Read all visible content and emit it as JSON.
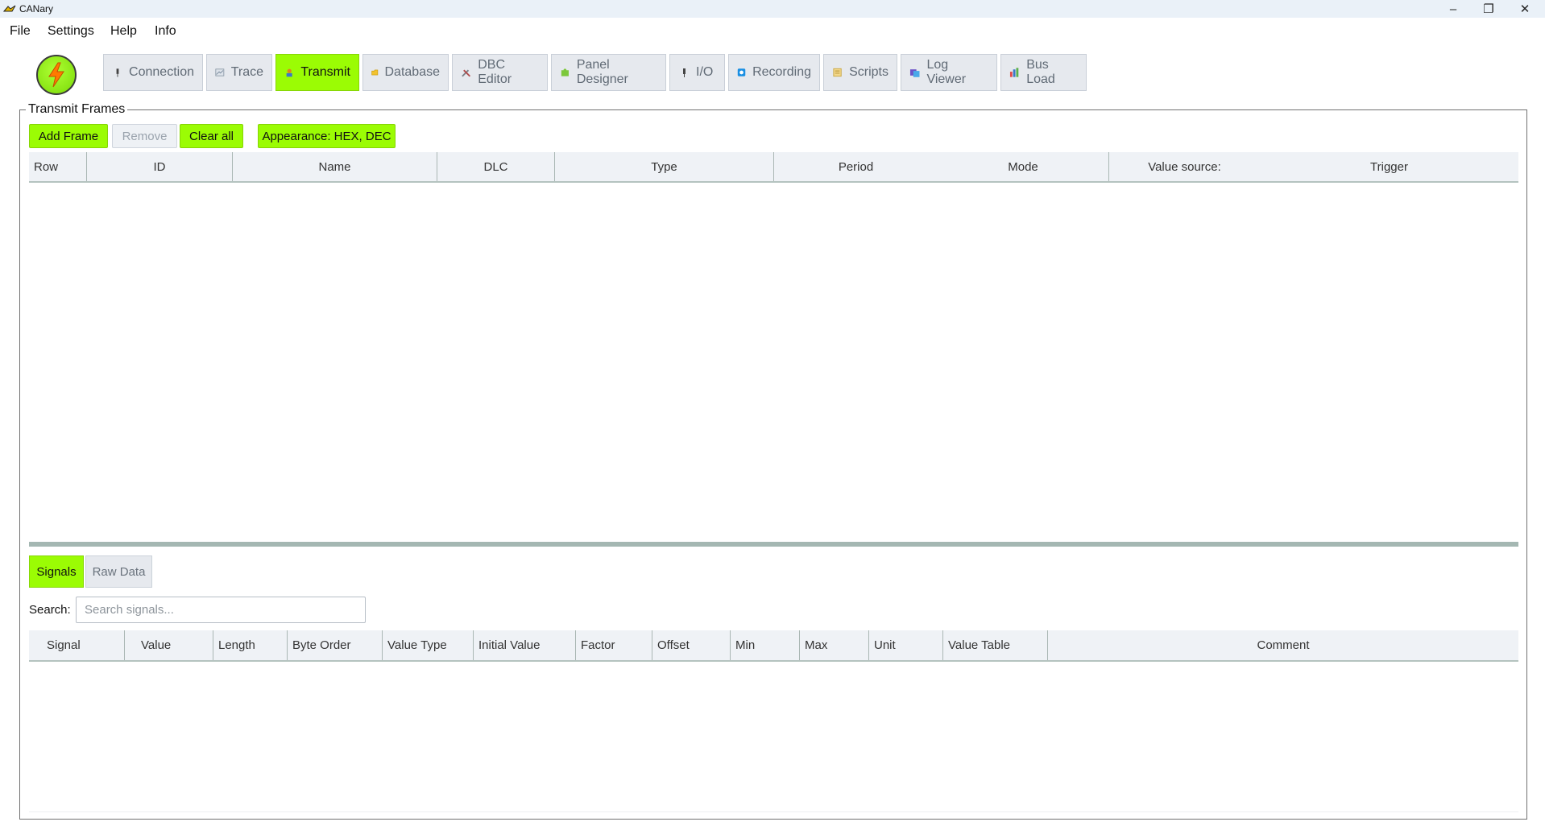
{
  "window": {
    "title": "CANary",
    "minimize": "–",
    "maximize": "❐",
    "close": "✕"
  },
  "menu": [
    "File",
    "Settings",
    "Help",
    "Info"
  ],
  "tabs": [
    {
      "label": "Connection",
      "icon": "plug-icon"
    },
    {
      "label": "Trace",
      "icon": "chart-icon"
    },
    {
      "label": "Transmit",
      "icon": "transmit-icon",
      "active": true
    },
    {
      "label": "Database",
      "icon": "folder-icon"
    },
    {
      "label": "DBC Editor",
      "icon": "tools-icon"
    },
    {
      "label": "Panel Designer",
      "icon": "puzzle-icon"
    },
    {
      "label": "I/O",
      "icon": "plug-icon"
    },
    {
      "label": "Recording",
      "icon": "record-icon"
    },
    {
      "label": "Scripts",
      "icon": "scroll-icon"
    },
    {
      "label": "Log Viewer",
      "icon": "log-icon"
    },
    {
      "label": "Bus Load",
      "icon": "bar-chart-icon"
    }
  ],
  "transmit": {
    "group_title": "Transmit Frames",
    "buttons": {
      "add": "Add Frame",
      "remove": "Remove",
      "clear": "Clear all",
      "appearance": "Appearance: HEX, DEC"
    },
    "columns": [
      "Row",
      "ID",
      "Name",
      "DLC",
      "Type",
      "Period",
      "Mode",
      "Value source:",
      "Trigger"
    ]
  },
  "signals": {
    "tabs": [
      "Signals",
      "Raw Data"
    ],
    "search_label": "Search:",
    "search_placeholder": "Search signals...",
    "columns": [
      "Signal",
      "Value",
      "Length",
      "Byte Order",
      "Value Type",
      "Initial Value",
      "Factor",
      "Offset",
      "Min",
      "Max",
      "Unit",
      "Value Table",
      "Comment"
    ]
  },
  "colors": {
    "accent": "#9bfc04",
    "tab_inactive": "#e6e9ee",
    "header_bg": "#eff2f6"
  }
}
